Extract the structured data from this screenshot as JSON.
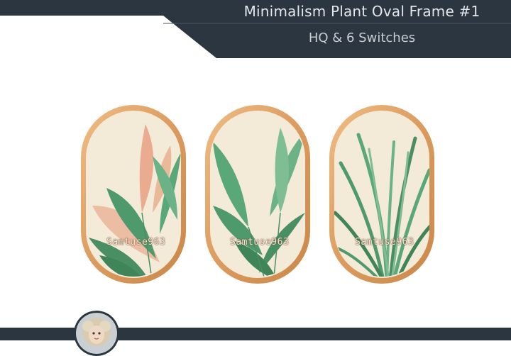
{
  "header": {
    "title": "Minimalism Plant Oval Frame #1",
    "subtitle": "HQ & 6 Switches"
  },
  "frames": [
    {
      "watermark": "Samtuse963",
      "plant": "tropical-leaves-pink-green"
    },
    {
      "watermark": "Samtuse963",
      "plant": "banana-leaves-green"
    },
    {
      "watermark": "Samtuse963",
      "plant": "grass-fronds-green"
    }
  ],
  "colors": {
    "banner": "#2b3641",
    "frame_wood": "#e2a56a",
    "canvas": "#f3ead8",
    "leaf_green": "#4f9a6c",
    "leaf_pink": "#e8a58a"
  },
  "icons": [
    "avatar-doll"
  ]
}
